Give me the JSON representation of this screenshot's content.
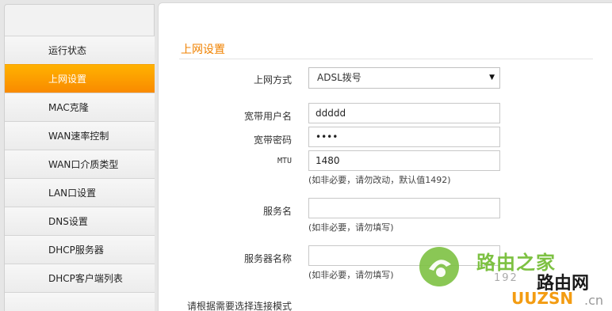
{
  "sidebar": {
    "items": [
      {
        "label": "运行状态"
      },
      {
        "label": "上网设置"
      },
      {
        "label": "MAC克隆"
      },
      {
        "label": "WAN速率控制"
      },
      {
        "label": "WAN口介质类型"
      },
      {
        "label": "LAN口设置"
      },
      {
        "label": "DNS设置"
      },
      {
        "label": "DHCP服务器"
      },
      {
        "label": "DHCP客户端列表"
      },
      {
        "label": ""
      }
    ],
    "active_index": 1
  },
  "main": {
    "section_title": "上网设置",
    "connection_type": {
      "label": "上网方式",
      "value": "ADSL拨号"
    },
    "username": {
      "label": "宽带用户名",
      "value": "ddddd"
    },
    "password": {
      "label": "宽带密码",
      "value": "••••"
    },
    "mtu": {
      "label": "MTU",
      "value": "1480",
      "hint": "(如非必要，请勿改动，默认值1492)"
    },
    "service_name": {
      "label": "服务名",
      "value": "",
      "hint": "(如非必要，请勿填写)"
    },
    "server_name": {
      "label": "服务器名称",
      "value": "",
      "hint": "(如非必要，请勿填写)"
    },
    "connect_mode_prompt": "请根据需要选择连接模式"
  },
  "watermark": {
    "brand": "路由之家",
    "url_prefix": "192",
    "site_text": "路由网",
    "site_latin": "UUZSN",
    "site_suffix": ".cn"
  },
  "colors": {
    "accent": "#f08200",
    "active_menu": "#fb9a00",
    "watermark_green": "#7dc142"
  }
}
